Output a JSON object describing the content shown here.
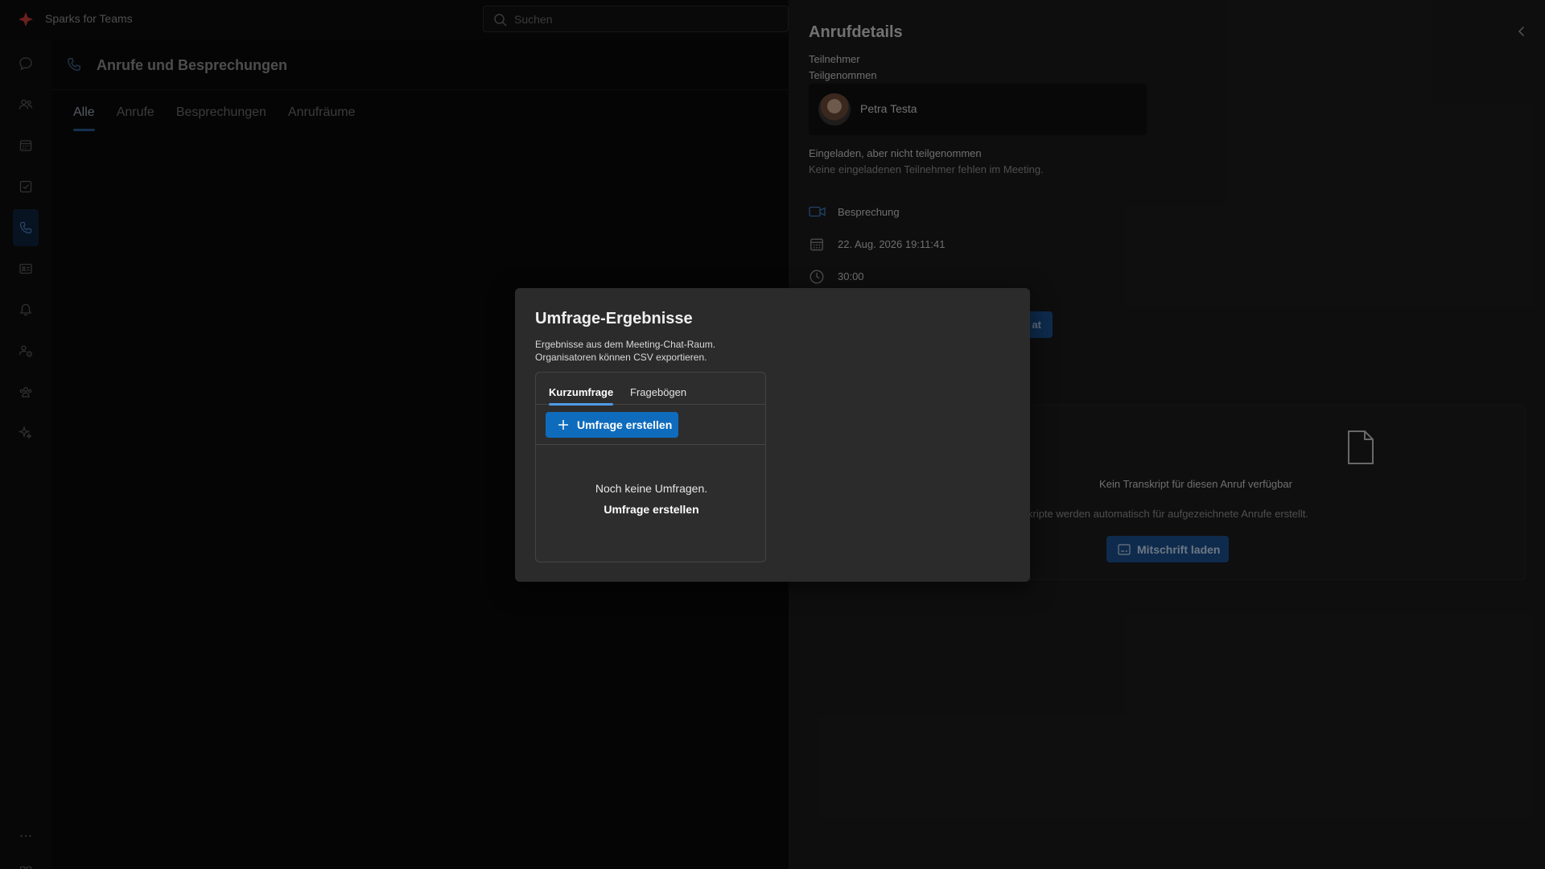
{
  "app": {
    "title": "Sparks for Teams"
  },
  "search": {
    "placeholder": "Suchen"
  },
  "rail": {
    "items": [
      {
        "name": "chat-icon"
      },
      {
        "name": "teams-icon"
      },
      {
        "name": "calendar-icon"
      },
      {
        "name": "tasks-icon"
      },
      {
        "name": "calls-icon",
        "active": true
      },
      {
        "name": "contacts-card-icon"
      },
      {
        "name": "bell-icon"
      },
      {
        "name": "people-settings-icon"
      },
      {
        "name": "community-icon"
      },
      {
        "name": "sparkle-icon"
      }
    ],
    "more": "⋯",
    "apps_icon": "apps-icon"
  },
  "main": {
    "title": "Anrufe und Besprechungen",
    "tabs": [
      {
        "label": "Alle",
        "active": true
      },
      {
        "label": "Anrufe"
      },
      {
        "label": "Besprechungen"
      },
      {
        "label": "Anrufräume"
      }
    ]
  },
  "details": {
    "title": "Anrufdetails",
    "participants_label": "Teilnehmer",
    "attended_label": "Teilgenommen",
    "participant_name": "Petra Testa",
    "invited_label": "Eingeladen, aber nicht teilgenommen",
    "invited_text": "Keine eingeladenen Teilnehmer fehlen im Meeting.",
    "type": "Besprechung",
    "datetime": "22. Aug. 2026 19:11:41",
    "duration": "30:00",
    "chat_button_partial": "at",
    "transcript_title": "Kein Transkript für diesen Anruf verfügbar",
    "transcript_text": "kripte werden automatisch für aufgezeichnete Anrufe erstellt.",
    "load_button": "Mitschrift laden"
  },
  "modal": {
    "title": "Umfrage-Ergebnisse",
    "desc_line1": "Ergebnisse aus dem Meeting-Chat-Raum.",
    "desc_line2": "Organisatoren können CSV exportieren.",
    "tabs": [
      {
        "label": "Kurzumfrage",
        "active": true
      },
      {
        "label": "Fragebögen"
      }
    ],
    "create_button": "Umfrage erstellen",
    "empty_text": "Noch keine Umfragen.",
    "empty_link": "Umfrage erstellen"
  },
  "colors": {
    "accent": "#0f6cbd",
    "panel": "#1b1b1b",
    "modal": "#2b2b2b"
  }
}
